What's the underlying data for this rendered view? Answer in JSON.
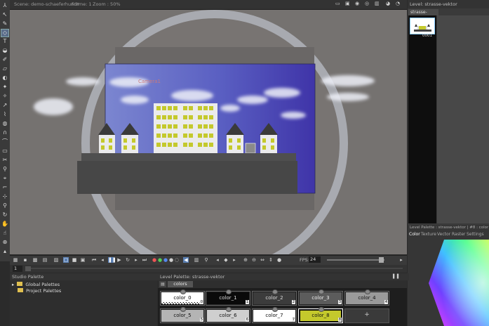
{
  "topbar": {
    "scene": "Scene: demo-schaeferhund*",
    "frame": "Frame: 1",
    "zoom": "Zoom : 50%"
  },
  "viewer": {
    "camera_label": "Camera1"
  },
  "bottombar": {
    "fps_label": "FPS:",
    "fps_value": "24"
  },
  "frame_field": "1",
  "level_panel": {
    "header": "Level: strasse-vektor",
    "tab": "strasse-vektor",
    "frame_number": "0001"
  },
  "style_editor": {
    "title": "Level Palette : strasse-vektor | #8 : color_8",
    "tabs": [
      "Color",
      "Texture",
      "Vector",
      "Raster",
      "Settings"
    ]
  },
  "studio_palette": {
    "title": "Studio Palette",
    "items": [
      "Global Palettes",
      "Project Palettes"
    ]
  },
  "level_palette": {
    "title": "Level Palette: strasse-vektor",
    "tab": "colors",
    "add_label": "+",
    "styles": [
      {
        "name": "color_0",
        "num": "0",
        "color": "#ffffff"
      },
      {
        "name": "color_1",
        "num": "1",
        "color": "#0a0a0a"
      },
      {
        "name": "color_2",
        "num": "2",
        "color": "#3c3c3c"
      },
      {
        "name": "color_3",
        "num": "3",
        "color": "#5c5c5c"
      },
      {
        "name": "color_4",
        "num": "4",
        "color": "#9a9a9a"
      },
      {
        "name": "color_5",
        "num": "5",
        "color": "#b4b4b4"
      },
      {
        "name": "color_6",
        "num": "6",
        "color": "#cfcfcf"
      },
      {
        "name": "color_7",
        "num": "7",
        "color": "#ffffff"
      },
      {
        "name": "color_8",
        "num": "8",
        "color": "#c4c92c"
      }
    ]
  },
  "colors": {
    "accent_blue": "#5a7fb3",
    "building_yellow": "#c4c92c",
    "sky_blue": "#4d4fb8"
  }
}
